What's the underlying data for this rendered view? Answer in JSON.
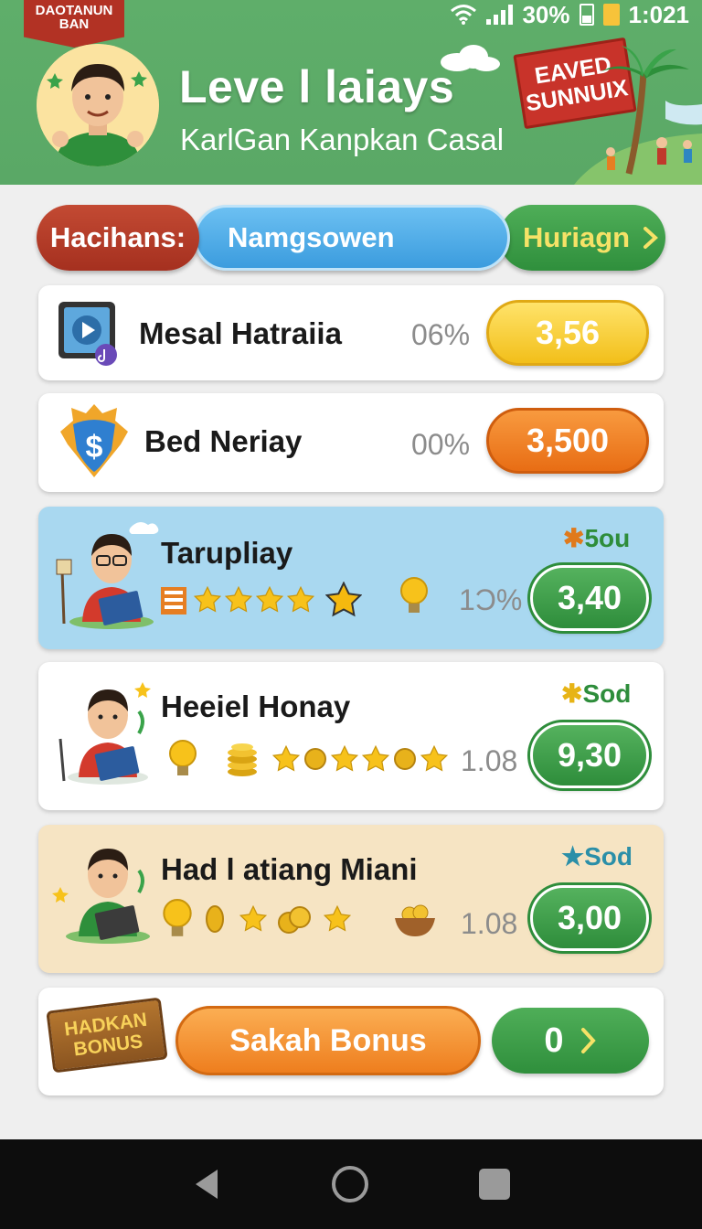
{
  "status_bar": {
    "battery": "30%",
    "time": "1:021"
  },
  "header": {
    "ribbon_text": "DAOTANUN BAN",
    "title": "Leve l laiays",
    "subtitle": "KarlGan Kanpkan Casal",
    "sign_text": "EAVED SUNNUIX"
  },
  "tabs": [
    {
      "label": "Hacihans:"
    },
    {
      "label": "Namgsowen"
    },
    {
      "label": "Huriagn"
    }
  ],
  "rows": [
    {
      "name": "Mesal Hatraiia",
      "percent": "06%",
      "value": "3,56",
      "icon": "video-play-icon"
    },
    {
      "name": "Bed Neriay",
      "percent": "00%",
      "value": "3,500",
      "icon": "dollar-shield-icon"
    },
    {
      "name": "Tarupliay",
      "percent": "1Ͻ%",
      "value": "3,40",
      "badge": "5ou"
    },
    {
      "name": "Heeiel Honay",
      "percent": "1.08",
      "value": "9,30",
      "badge": "Sod"
    },
    {
      "name": "Had l atiang Miani",
      "percent": "1.08",
      "value": "3,00",
      "badge": "Sod"
    }
  ],
  "bonus": {
    "wood_sign": "HADKAN BONUS",
    "button_label": "Sakah Bonus",
    "count": "0"
  },
  "colors": {
    "header_green": "#5fae6a",
    "accent_green": "#2e8d3b",
    "accent_orange": "#e86d14",
    "accent_yellow": "#f2bf1a"
  }
}
